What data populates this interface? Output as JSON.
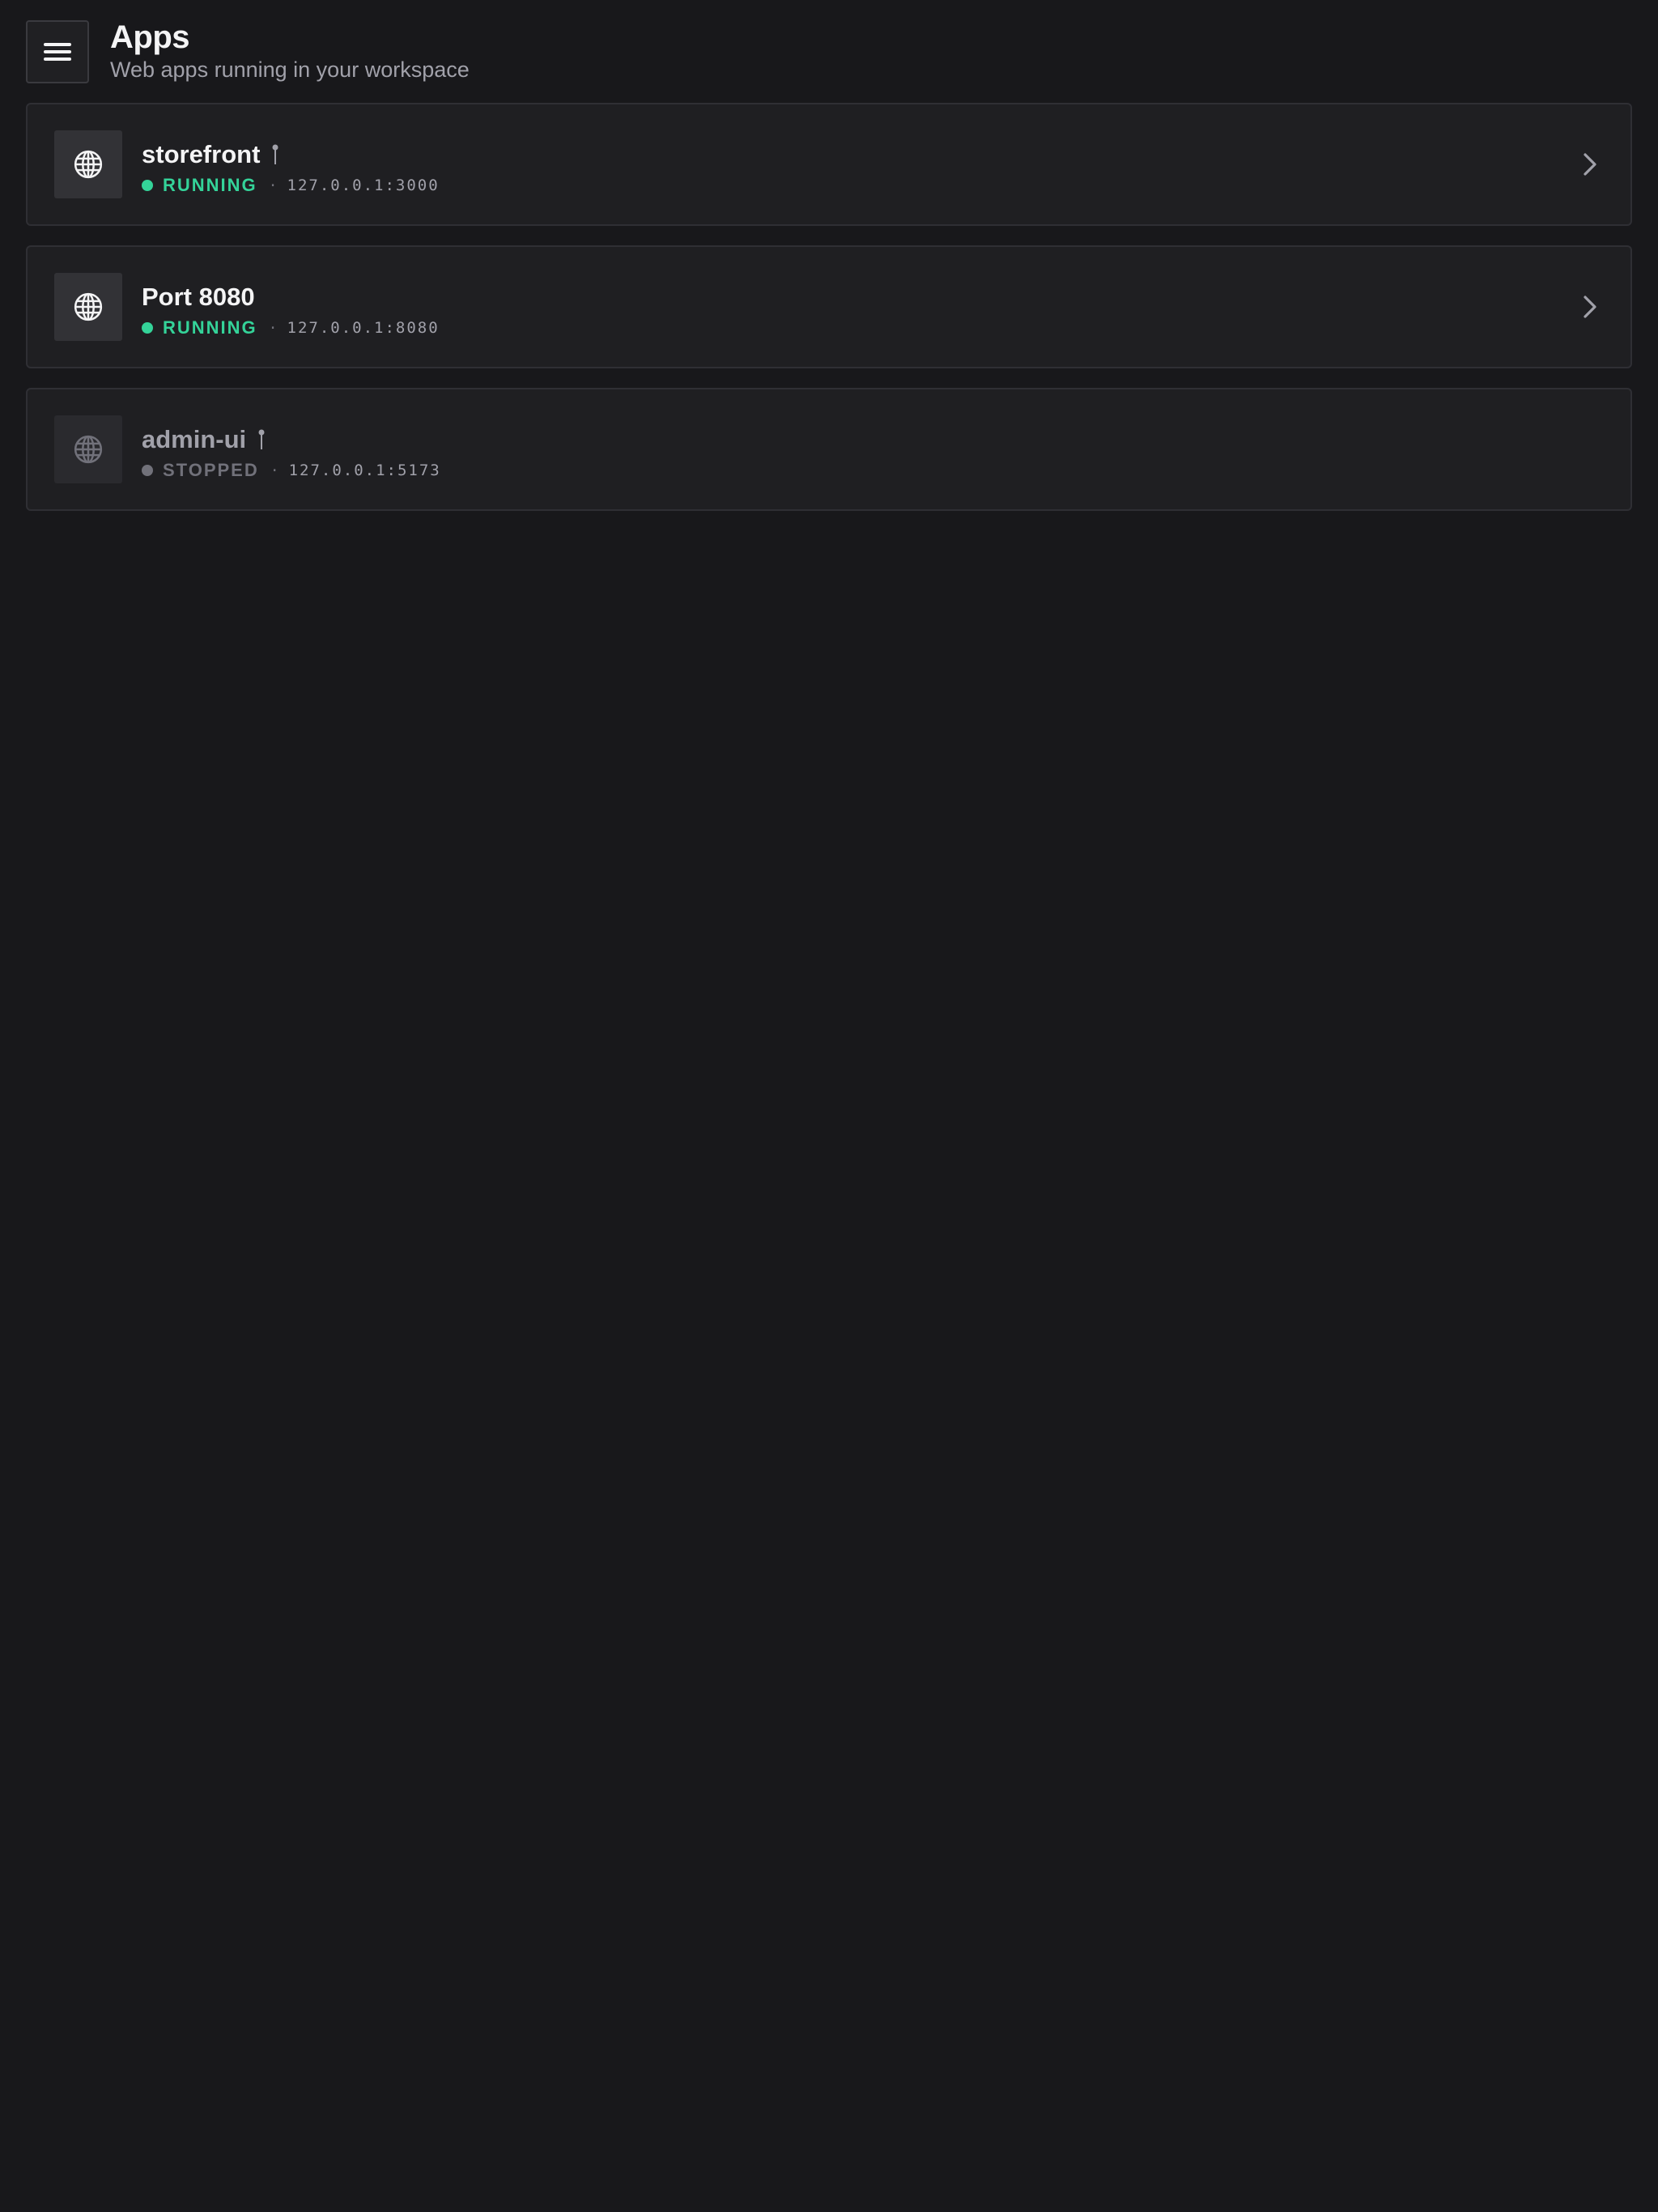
{
  "header": {
    "title": "Apps",
    "subtitle": "Web apps running in your workspace",
    "menu_icon": "hamburger-menu-icon"
  },
  "apps": [
    {
      "name": "storefront",
      "pinned": true,
      "status": "RUNNING",
      "address": "127.0.0.1:3000",
      "separator": "·",
      "icon": "globe-icon",
      "has_chevron": true
    },
    {
      "name": "Port 8080",
      "pinned": false,
      "status": "RUNNING",
      "address": "127.0.0.1:8080",
      "separator": "·",
      "icon": "globe-icon",
      "has_chevron": true
    },
    {
      "name": "admin-ui",
      "pinned": true,
      "status": "STOPPED",
      "address": "127.0.0.1:5173",
      "separator": "·",
      "icon": "globe-icon",
      "has_chevron": false
    }
  ],
  "colors": {
    "background": "#18181b",
    "card": "#1f1f22",
    "running": "#34d399",
    "stopped": "#71717a",
    "text_primary": "#f4f4f5",
    "text_secondary": "#a1a1aa"
  }
}
